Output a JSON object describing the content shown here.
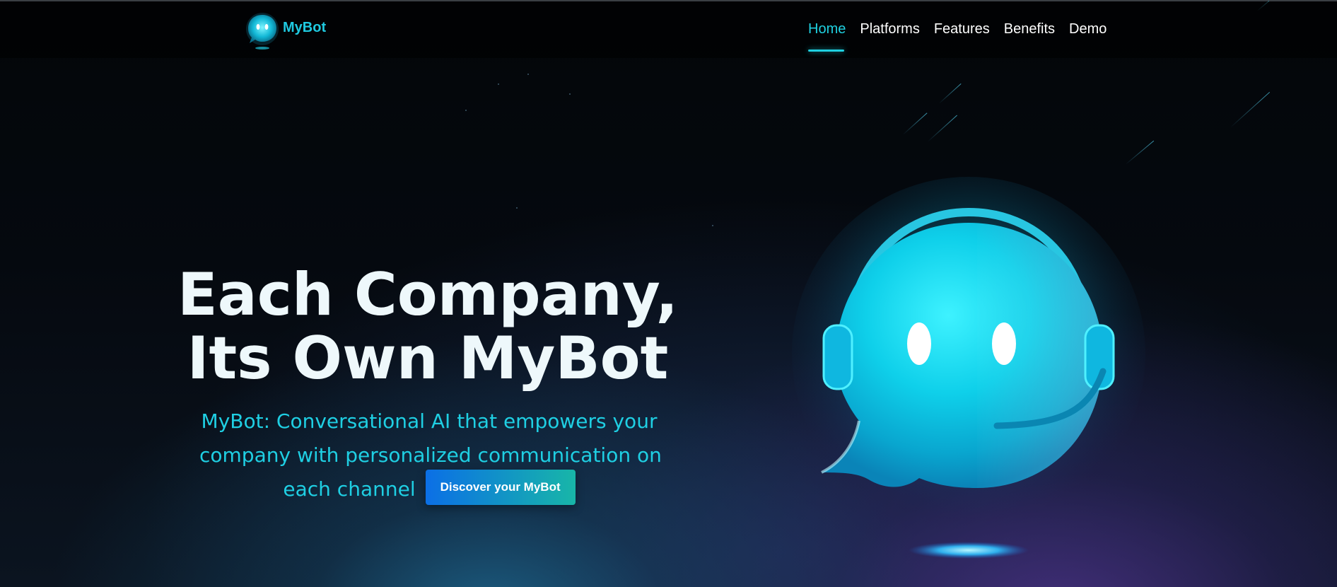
{
  "brand": {
    "name": "MyBot",
    "logo_icon": "chat-bubble-bot-icon"
  },
  "nav": {
    "items": [
      {
        "label": "Home",
        "active": true
      },
      {
        "label": "Platforms",
        "active": false
      },
      {
        "label": "Features",
        "active": false
      },
      {
        "label": "Benefits",
        "active": false
      },
      {
        "label": "Demo",
        "active": false
      }
    ]
  },
  "hero": {
    "title_line1": "Each Company,",
    "title_line2": "Its Own MyBot",
    "subtitle_line1": "MyBot: Conversational AI that empowers your",
    "subtitle_line2": "company with personalized communication on",
    "subtitle_line3": "each channel",
    "cta_label": "Discover your MyBot",
    "illustration": "chat-bubble-bot-with-headset-icon"
  },
  "colors": {
    "accent": "#1fd0e0",
    "title": "#eef8fb",
    "cta_start": "#0b6fe6",
    "cta_end": "#18b6a8",
    "background": "#02060a"
  }
}
